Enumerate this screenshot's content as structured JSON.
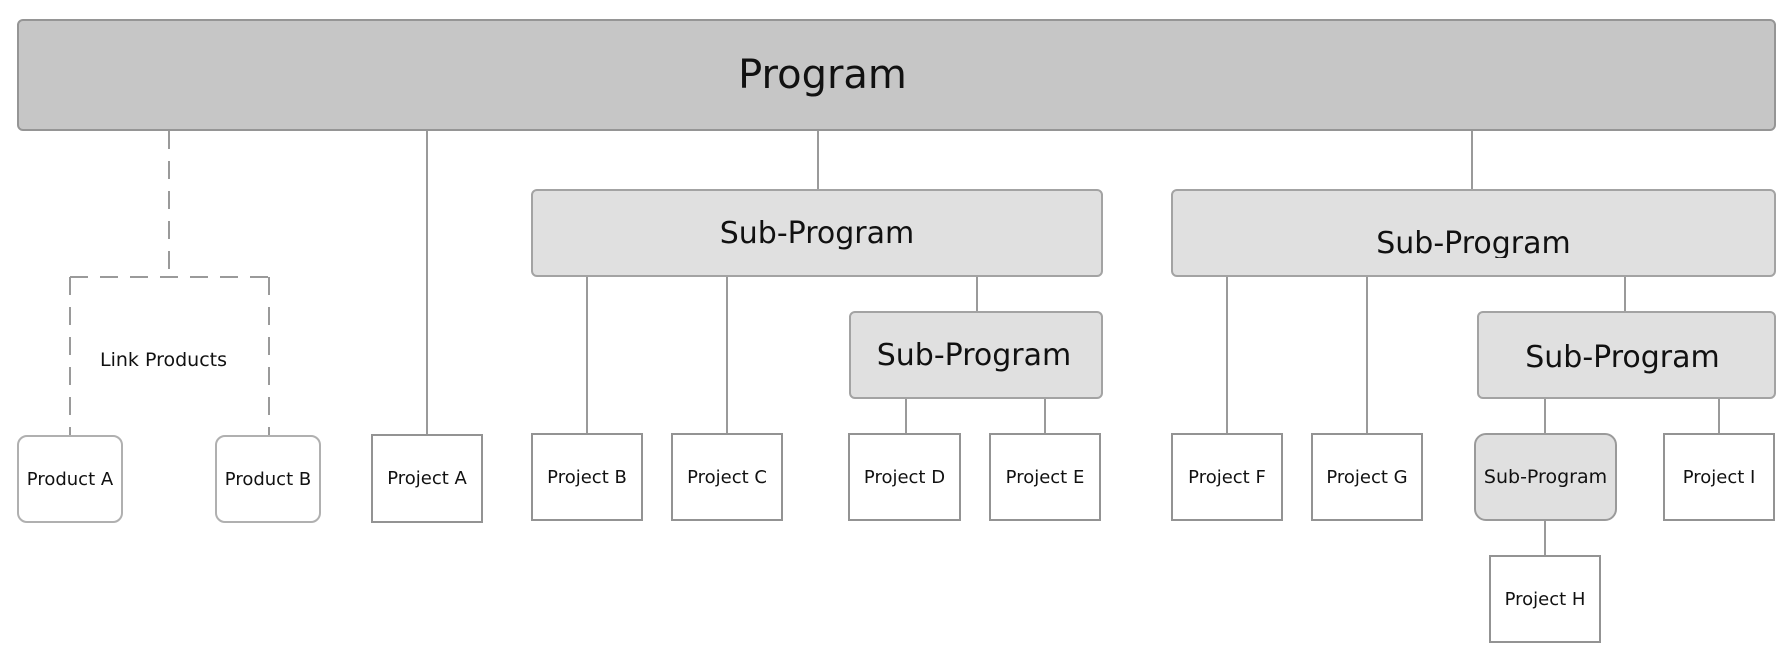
{
  "diagram": {
    "root": {
      "label": "Program"
    },
    "link_group": {
      "label": "Link Products"
    },
    "products": [
      {
        "label": "Product A"
      },
      {
        "label": "Product B"
      }
    ],
    "projects": {
      "a": "Project A",
      "b": "Project B",
      "c": "Project C",
      "d": "Project D",
      "e": "Project E",
      "f": "Project F",
      "g": "Project G",
      "h": "Project H",
      "i": "Project I"
    },
    "sub_programs": {
      "left": "Sub-Program",
      "left_nested": "Sub-Program",
      "right": "Sub-Program",
      "right_nested": "Sub-Program",
      "right_nested_child": "Sub-Program"
    },
    "colors": {
      "program_fill": "#c6c6c6",
      "sub_program_fill": "#e0e0e0",
      "connector": "#999999"
    }
  }
}
